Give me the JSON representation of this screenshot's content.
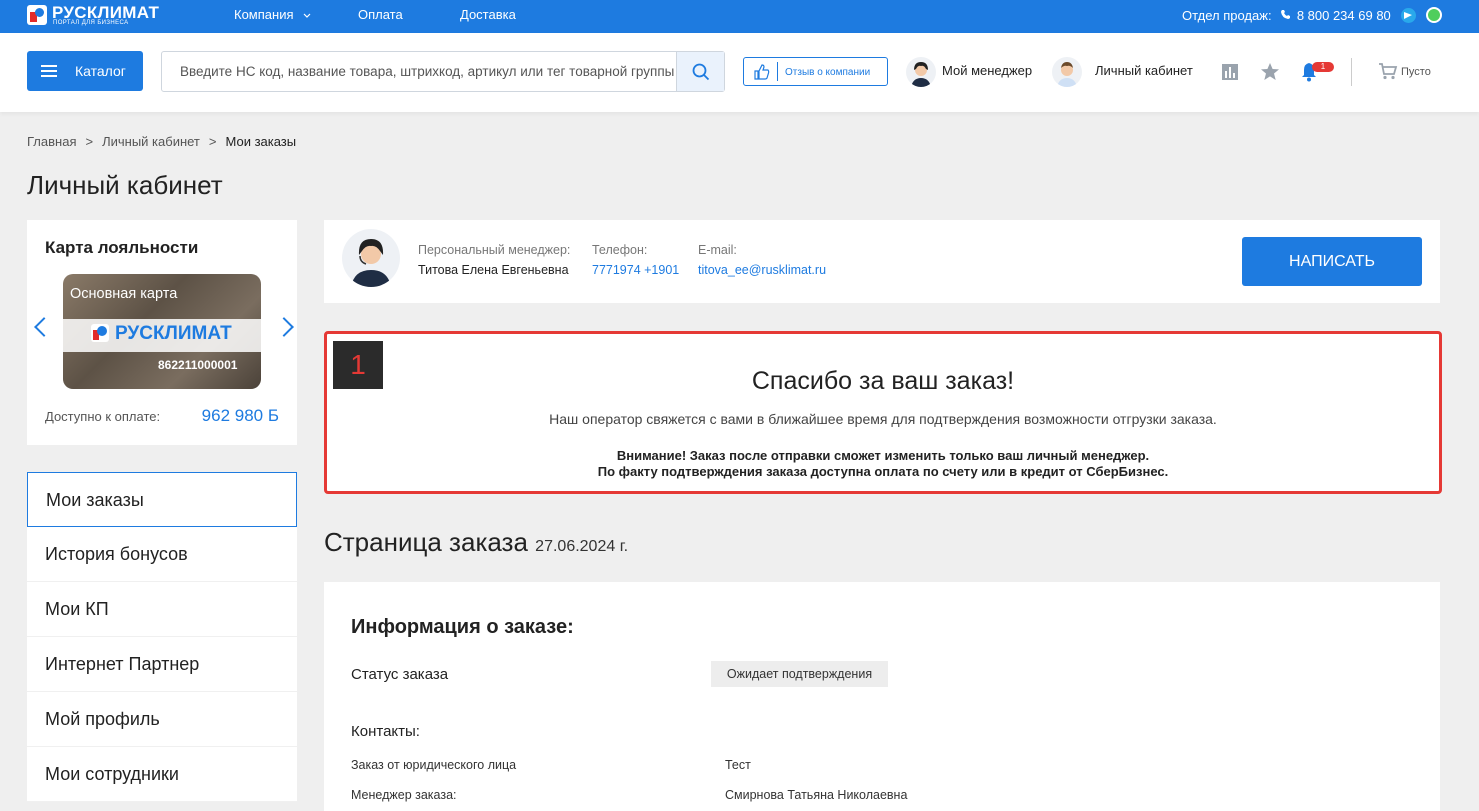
{
  "topbar": {
    "logo_name": "РУСКЛИМАТ",
    "logo_sub": "ПОРТАЛ ДЛЯ БИЗНЕСА",
    "nav": [
      "Компания",
      "Оплата",
      "Доставка"
    ],
    "sales_label": "Отдел продаж:",
    "sales_phone": "8 800 234 69 80"
  },
  "header": {
    "catalog_label": "Каталог",
    "search_placeholder": "Введите НС код, название товара, штрихкод, артикул или тег товарной группы",
    "review_label": "Отзыв о компании",
    "manager_link": "Мой менеджер",
    "account_link": "Личный кабинет",
    "notifications_count": "1",
    "cart_label": "Пусто"
  },
  "breadcrumb": [
    "Главная",
    "Личный кабинет",
    "Мои заказы"
  ],
  "page_title": "Личный кабинет",
  "loyalty": {
    "title": "Карта лояльности",
    "card_name": "Основная карта",
    "card_brand": "РУСКЛИМАТ",
    "card_number": "862211000001",
    "available_label": "Доступно к оплате:",
    "available_value": "962 980 Б"
  },
  "menu": [
    "Мои заказы",
    "История бонусов",
    "Мои КП",
    "Интернет Партнер",
    "Мой профиль",
    "Мои сотрудники"
  ],
  "manager": {
    "label": "Персональный менеджер:",
    "name": "Титова Елена Евгеньевна",
    "phone_label": "Телефон:",
    "phone": "7771974 +1901",
    "email_label": "E-mail:",
    "email": "titova_ee@rusklimat.ru",
    "write_button": "НАПИСАТЬ"
  },
  "thanks": {
    "marker": "1",
    "title": "Спасибо за ваш заказ!",
    "text": "Наш оператор свяжется с вами в ближайшее время для подтверждения возможности отгрузки заказа.",
    "warning1": "Внимание! Заказ после отправки сможет изменить только ваш личный менеджер.",
    "warning2": "По факту подтверждения заказа доступна оплата по счету или в кредит от СберБизнес."
  },
  "order": {
    "title": "Страница заказа",
    "date": "27.06.2024 г.",
    "info_title": "Информация о заказе:",
    "status_label": "Статус заказа",
    "status_value": "Ожидает подтверждения",
    "contacts_title": "Контакты:",
    "legal_label": "Заказ от юридического лица",
    "legal_value": "Тест",
    "manager_label": "Менеджер заказа:",
    "manager_value": "Смирнова Татьяна Николаевна"
  },
  "colors": {
    "accent": "#1e7be0",
    "alert": "#e53935"
  }
}
